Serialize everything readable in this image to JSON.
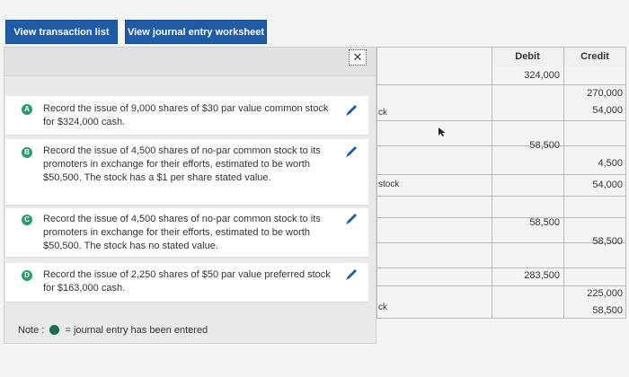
{
  "tabs": {
    "transaction_list": "View transaction list",
    "journal_worksheet": "View journal entry worksheet"
  },
  "transactions": [
    {
      "badge": "A",
      "text": "Record the issue of 9,000 shares of $30 par value common stock for $324,000 cash."
    },
    {
      "badge": "B",
      "text": "Record the issue of 4,500 shares of no-par common stock to its promoters in exchange for their efforts, estimated to be worth $50,500. The stock has a $1 per share stated value."
    },
    {
      "badge": "C",
      "text": "Record the issue of 4,500 shares of no-par common stock to its promoters in exchange for their efforts, estimated to be worth $50,500. The stock has no stated value."
    },
    {
      "badge": "D",
      "text": "Record the issue of 2,250 shares of $50 par value preferred stock for $163,000 cash."
    }
  ],
  "note": {
    "prefix": "Note :",
    "suffix": "= journal entry has been entered"
  },
  "journal": {
    "debit_header": "Debit",
    "credit_header": "Credit",
    "account_fragments": [
      "ck",
      "stock",
      "ck"
    ],
    "entries": {
      "r1_debit": "324,000",
      "r2_credit": "270,000",
      "r3_credit": "54,000",
      "r4_debit": "58,500",
      "r5_credit": "4,500",
      "r6_credit": "54,000",
      "r7_debit": "58,500",
      "r8_credit": "58,500",
      "r9_debit": "283,500",
      "r10_credit": "225,000",
      "r11_credit": "58,500"
    }
  },
  "colors": {
    "tab_blue": "#1f5ba8",
    "badge_green": "#2a9b6b",
    "note_dot": "#1b6e4c",
    "pencil_blue": "#1f5ba8"
  }
}
